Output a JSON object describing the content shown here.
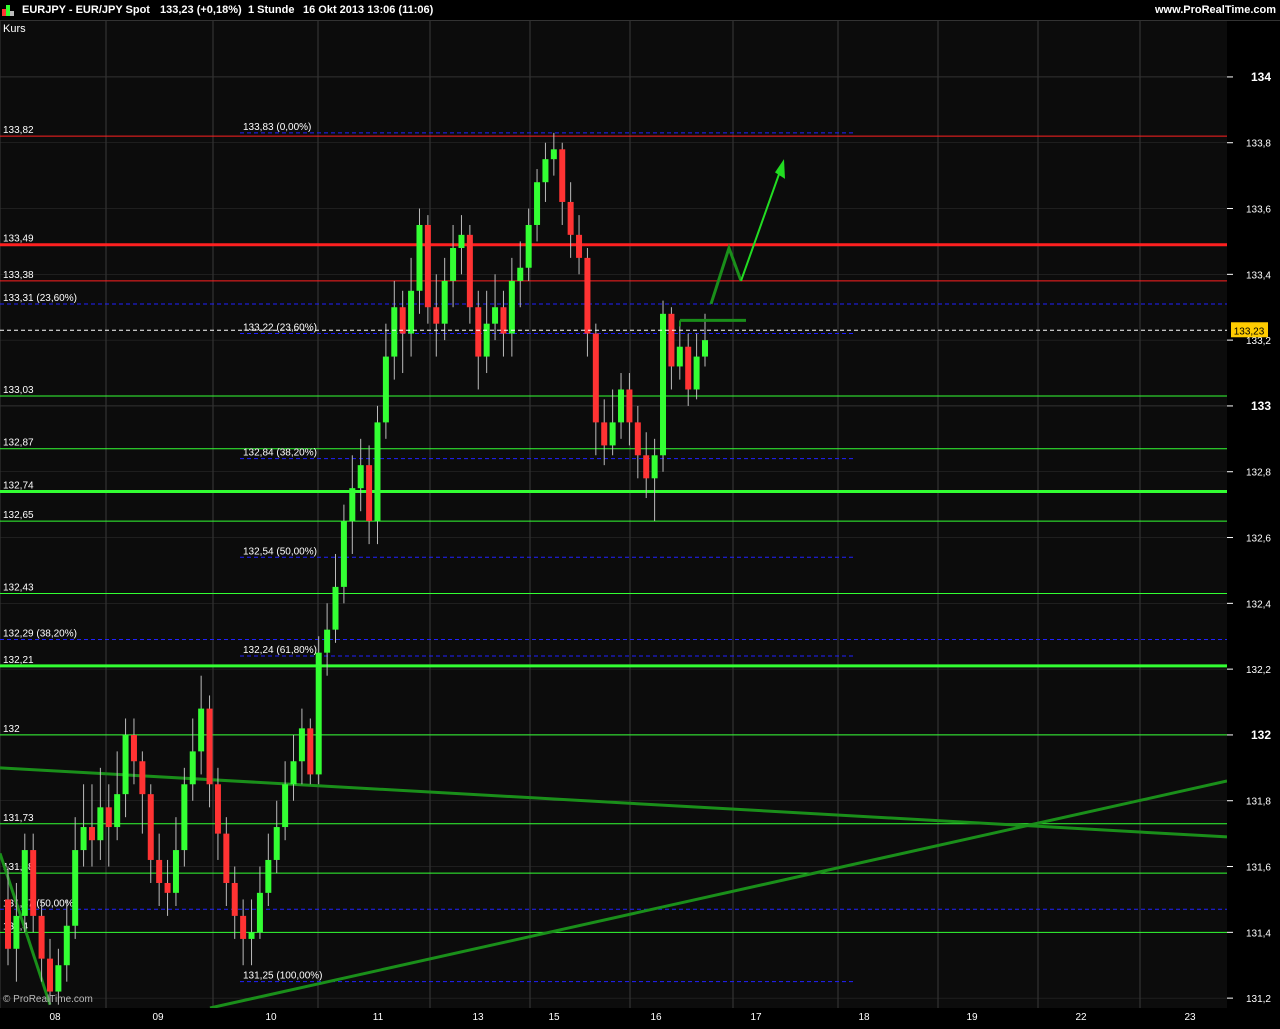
{
  "header": {
    "symbol": "EURJPY - EUR/JPY Spot",
    "price_change": "133,23 (+0,18%)",
    "timeframe": "1 Stunde",
    "datetime": "16 Okt 2013 13:06 (11:06)",
    "website": "www.ProRealTime.com"
  },
  "panel_label": "Kurs",
  "watermark": "© ProRealTime.com",
  "current_price_label": "133,23",
  "colors": {
    "up": "#33ff33",
    "down": "#ff3333",
    "resistance": "#ff2020",
    "support": "#33ff33",
    "fib": "#2020ff",
    "trend": "#1a8f1a",
    "background": "#0c0c0c"
  },
  "chart_data": {
    "type": "candlestick",
    "y_axis": {
      "ylim": [
        131.17,
        134.17
      ],
      "ticks": [
        "134",
        "133,8",
        "133,6",
        "133,4",
        "133,2",
        "133",
        "132,8",
        "132,6",
        "132,4",
        "132,2",
        "132",
        "131,8",
        "131,6",
        "131,4",
        "131,2"
      ],
      "bold_ticks": [
        "134",
        "133",
        "132"
      ]
    },
    "x_axis": {
      "ticks": [
        "08",
        "09",
        "10",
        "11",
        "13",
        "15",
        "16",
        "17",
        "18",
        "19",
        "22",
        "23"
      ]
    },
    "horizontal_lines": [
      {
        "label": "133,82",
        "value": 133.82,
        "color": "red",
        "thick": false
      },
      {
        "label": "133,49",
        "value": 133.49,
        "color": "red",
        "thick": true
      },
      {
        "label": "133,38",
        "value": 133.38,
        "color": "red",
        "thick": false
      },
      {
        "label": "133,03",
        "value": 133.03,
        "color": "green",
        "thick": false
      },
      {
        "label": "132,87",
        "value": 132.87,
        "color": "green",
        "thick": false
      },
      {
        "label": "132,74",
        "value": 132.74,
        "color": "green",
        "thick": true
      },
      {
        "label": "132,65",
        "value": 132.65,
        "color": "green",
        "thick": false
      },
      {
        "label": "132,43",
        "value": 132.43,
        "color": "green",
        "thick": false
      },
      {
        "label": "132,21",
        "value": 132.21,
        "color": "green",
        "thick": true
      },
      {
        "label": "132",
        "value": 132.0,
        "color": "green",
        "thick": false
      },
      {
        "label": "131,73",
        "value": 131.73,
        "color": "green",
        "thick": false
      },
      {
        "label": "131,58",
        "value": 131.58,
        "color": "green",
        "thick": false
      },
      {
        "label": "131,4",
        "value": 131.4,
        "color": "green",
        "thick": false
      }
    ],
    "fib_levels_left": [
      {
        "label": "133,31 (23,60%)",
        "value": 133.31
      },
      {
        "label": "132,29 (38,20%)",
        "value": 132.29
      },
      {
        "label": "131,47 (50,00%)",
        "value": 131.47
      }
    ],
    "fib_levels_mid": [
      {
        "label": "133,83 (0,00%)",
        "value": 133.83
      },
      {
        "label": "133,22 (23,60%)",
        "value": 133.22
      },
      {
        "label": "132,84 (38,20%)",
        "value": 132.84
      },
      {
        "label": "132,54 (50,00%)",
        "value": 132.54
      },
      {
        "label": "132,24 (61,80%)",
        "value": 132.24
      },
      {
        "label": "131,25 (100,00%)",
        "value": 131.25
      }
    ],
    "current_price": 133.23,
    "candles": [
      [
        131.5,
        131.35,
        131.6,
        131.3
      ],
      [
        131.35,
        131.45,
        131.55,
        131.25
      ],
      [
        131.45,
        131.65,
        131.7,
        131.4
      ],
      [
        131.65,
        131.45,
        131.7,
        131.4
      ],
      [
        131.45,
        131.32,
        131.5,
        131.25
      ],
      [
        131.32,
        131.22,
        131.38,
        131.18
      ],
      [
        131.22,
        131.3,
        131.35,
        131.18
      ],
      [
        131.3,
        131.42,
        131.5,
        131.25
      ],
      [
        131.42,
        131.65,
        131.75,
        131.38
      ],
      [
        131.65,
        131.72,
        131.85,
        131.6
      ],
      [
        131.72,
        131.68,
        131.85,
        131.6
      ],
      [
        131.68,
        131.78,
        131.9,
        131.62
      ],
      [
        131.78,
        131.72,
        131.85,
        131.6
      ],
      [
        131.72,
        131.82,
        131.95,
        131.68
      ],
      [
        131.82,
        132.0,
        132.05,
        131.75
      ],
      [
        132.0,
        131.92,
        132.05,
        131.85
      ],
      [
        131.92,
        131.82,
        131.95,
        131.7
      ],
      [
        131.82,
        131.62,
        131.85,
        131.55
      ],
      [
        131.62,
        131.55,
        131.7,
        131.48
      ],
      [
        131.55,
        131.52,
        131.62,
        131.45
      ],
      [
        131.52,
        131.65,
        131.75,
        131.48
      ],
      [
        131.65,
        131.85,
        131.9,
        131.6
      ],
      [
        131.85,
        131.95,
        132.05,
        131.8
      ],
      [
        131.95,
        132.08,
        132.18,
        131.88
      ],
      [
        132.08,
        131.85,
        132.12,
        131.78
      ],
      [
        131.85,
        131.7,
        131.9,
        131.62
      ],
      [
        131.7,
        131.55,
        131.75,
        131.48
      ],
      [
        131.55,
        131.45,
        131.6,
        131.38
      ],
      [
        131.45,
        131.38,
        131.5,
        131.3
      ],
      [
        131.38,
        131.4,
        131.5,
        131.3
      ],
      [
        131.4,
        131.52,
        131.6,
        131.38
      ],
      [
        131.52,
        131.62,
        131.7,
        131.48
      ],
      [
        131.62,
        131.72,
        131.8,
        131.58
      ],
      [
        131.72,
        131.85,
        131.92,
        131.68
      ],
      [
        131.85,
        131.92,
        132.0,
        131.8
      ],
      [
        131.92,
        132.02,
        132.08,
        131.85
      ],
      [
        132.02,
        131.88,
        132.05,
        131.85
      ],
      [
        131.88,
        132.25,
        132.3,
        131.85
      ],
      [
        132.25,
        132.32,
        132.4,
        132.18
      ],
      [
        132.32,
        132.45,
        132.55,
        132.28
      ],
      [
        132.45,
        132.65,
        132.7,
        132.4
      ],
      [
        132.65,
        132.75,
        132.85,
        132.55
      ],
      [
        132.75,
        132.82,
        132.9,
        132.68
      ],
      [
        132.82,
        132.65,
        132.88,
        132.58
      ],
      [
        132.65,
        132.95,
        133.0,
        132.58
      ],
      [
        132.95,
        133.15,
        133.25,
        132.9
      ],
      [
        133.15,
        133.3,
        133.38,
        133.08
      ],
      [
        133.3,
        133.22,
        133.35,
        133.1
      ],
      [
        133.22,
        133.35,
        133.45,
        133.15
      ],
      [
        133.35,
        133.55,
        133.6,
        133.28
      ],
      [
        133.55,
        133.3,
        133.58,
        133.25
      ],
      [
        133.3,
        133.25,
        133.4,
        133.15
      ],
      [
        133.25,
        133.38,
        133.45,
        133.2
      ],
      [
        133.38,
        133.48,
        133.55,
        133.3
      ],
      [
        133.48,
        133.52,
        133.58,
        133.4
      ],
      [
        133.52,
        133.3,
        133.55,
        133.25
      ],
      [
        133.3,
        133.15,
        133.35,
        133.05
      ],
      [
        133.15,
        133.25,
        133.35,
        133.1
      ],
      [
        133.25,
        133.3,
        133.4,
        133.2
      ],
      [
        133.3,
        133.22,
        133.35,
        133.15
      ],
      [
        133.22,
        133.38,
        133.45,
        133.15
      ],
      [
        133.38,
        133.42,
        133.5,
        133.3
      ],
      [
        133.42,
        133.55,
        133.6,
        133.38
      ],
      [
        133.55,
        133.68,
        133.72,
        133.5
      ],
      [
        133.68,
        133.75,
        133.8,
        133.62
      ],
      [
        133.75,
        133.78,
        133.83,
        133.7
      ],
      [
        133.78,
        133.62,
        133.8,
        133.55
      ],
      [
        133.62,
        133.52,
        133.68,
        133.45
      ],
      [
        133.52,
        133.45,
        133.58,
        133.4
      ],
      [
        133.45,
        133.22,
        133.48,
        133.15
      ],
      [
        133.22,
        132.95,
        133.25,
        132.85
      ],
      [
        132.95,
        132.88,
        133.02,
        132.82
      ],
      [
        132.88,
        132.95,
        133.05,
        132.85
      ],
      [
        132.95,
        133.05,
        133.1,
        132.9
      ],
      [
        133.05,
        132.95,
        133.1,
        132.88
      ],
      [
        132.95,
        132.85,
        133.0,
        132.78
      ],
      [
        132.85,
        132.78,
        132.92,
        132.72
      ],
      [
        132.78,
        132.85,
        132.9,
        132.65
      ],
      [
        132.85,
        133.28,
        133.32,
        132.8
      ],
      [
        133.28,
        133.12,
        133.3,
        133.05
      ],
      [
        133.12,
        133.18,
        133.25,
        133.08
      ],
      [
        133.18,
        133.05,
        133.22,
        133.0
      ],
      [
        133.05,
        133.15,
        133.22,
        133.02
      ],
      [
        133.15,
        133.2,
        133.28,
        133.12
      ]
    ],
    "annotations": [
      {
        "type": "trendline",
        "points": [
          [
            131.9,
            0
          ],
          [
            131.69,
            1
          ]
        ]
      },
      {
        "type": "trendline",
        "points": [
          [
            131.1,
            0.17
          ],
          [
            131.86,
            1
          ]
        ]
      },
      {
        "type": "arrow-projection",
        "path": [
          133.31,
          133.48,
          133.38,
          133.73
        ]
      },
      {
        "type": "breakout-line",
        "value": 133.26
      }
    ]
  }
}
